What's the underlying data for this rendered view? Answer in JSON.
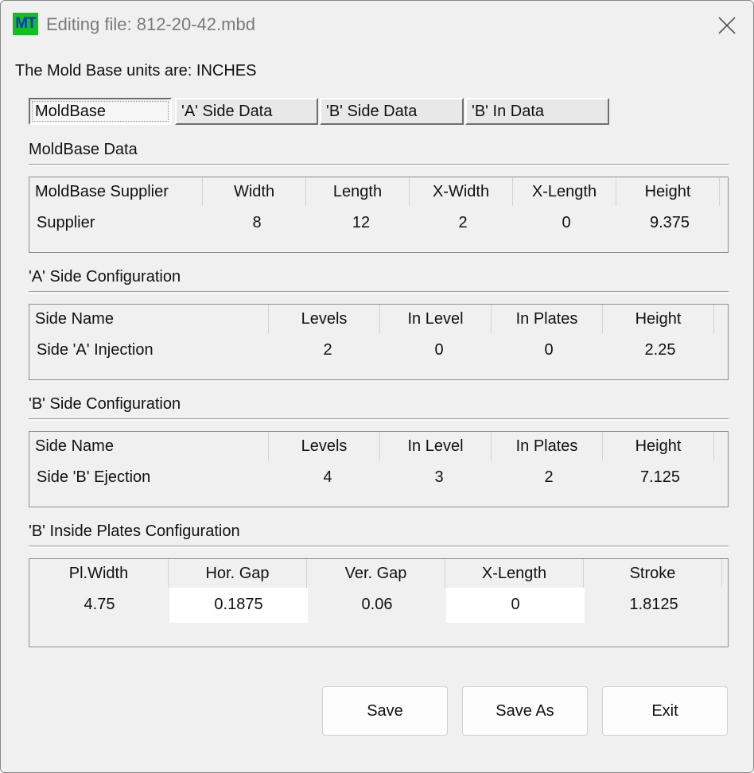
{
  "window": {
    "app_icon_text": "MT",
    "title": "Editing file: 812-20-42.mbd"
  },
  "units_label": "The Mold Base units are: INCHES",
  "tabs": [
    {
      "label": "MoldBase",
      "active": true
    },
    {
      "label": "'A' Side Data",
      "active": false
    },
    {
      "label": "'B' Side Data",
      "active": false
    },
    {
      "label": "'B' In Data",
      "active": false
    }
  ],
  "moldbase": {
    "title": "MoldBase Data",
    "headers": [
      "MoldBase Supplier",
      "Width",
      "Length",
      "X-Width",
      "X-Length",
      "Height"
    ],
    "row": [
      "Supplier",
      "8",
      "12",
      "2",
      "0",
      "9.375"
    ]
  },
  "a_side": {
    "title": "'A' Side Configuration",
    "headers": [
      "Side Name",
      "Levels",
      "In Level",
      "In Plates",
      "Height"
    ],
    "row": [
      "Side 'A' Injection",
      "2",
      "0",
      "0",
      "2.25"
    ]
  },
  "b_side": {
    "title": "'B' Side Configuration",
    "headers": [
      "Side Name",
      "Levels",
      "In Level",
      "In Plates",
      "Height"
    ],
    "row": [
      "Side 'B' Ejection",
      "4",
      "3",
      "2",
      "7.125"
    ]
  },
  "b_inside": {
    "title": "'B' Inside Plates Configuration",
    "headers": [
      "Pl.Width",
      "Hor. Gap",
      "Ver. Gap",
      "X-Length",
      "Stroke"
    ],
    "row": [
      "4.75",
      "0.1875",
      "0.06",
      "0",
      "1.8125"
    ]
  },
  "buttons": {
    "save": "Save",
    "save_as": "Save As",
    "exit": "Exit"
  }
}
